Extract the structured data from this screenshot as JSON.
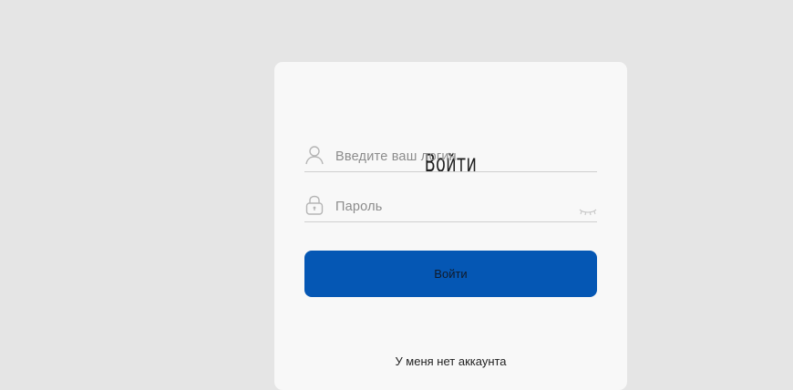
{
  "login_form": {
    "title": "Войти",
    "login_field": {
      "placeholder": "Введите ваш логин",
      "icon": "user-icon"
    },
    "password_field": {
      "placeholder": "Пароль",
      "icon": "lock-icon",
      "toggle_icon": "eye-closed-icon"
    },
    "submit_label": "Войти",
    "no_account_link": "У меня нет аккаунта"
  },
  "colors": {
    "background": "#e5e5e5",
    "card": "#f8f8f8",
    "button": "#0557b4",
    "placeholder_text": "#8c8c8c",
    "divider": "#cfcfcf"
  }
}
